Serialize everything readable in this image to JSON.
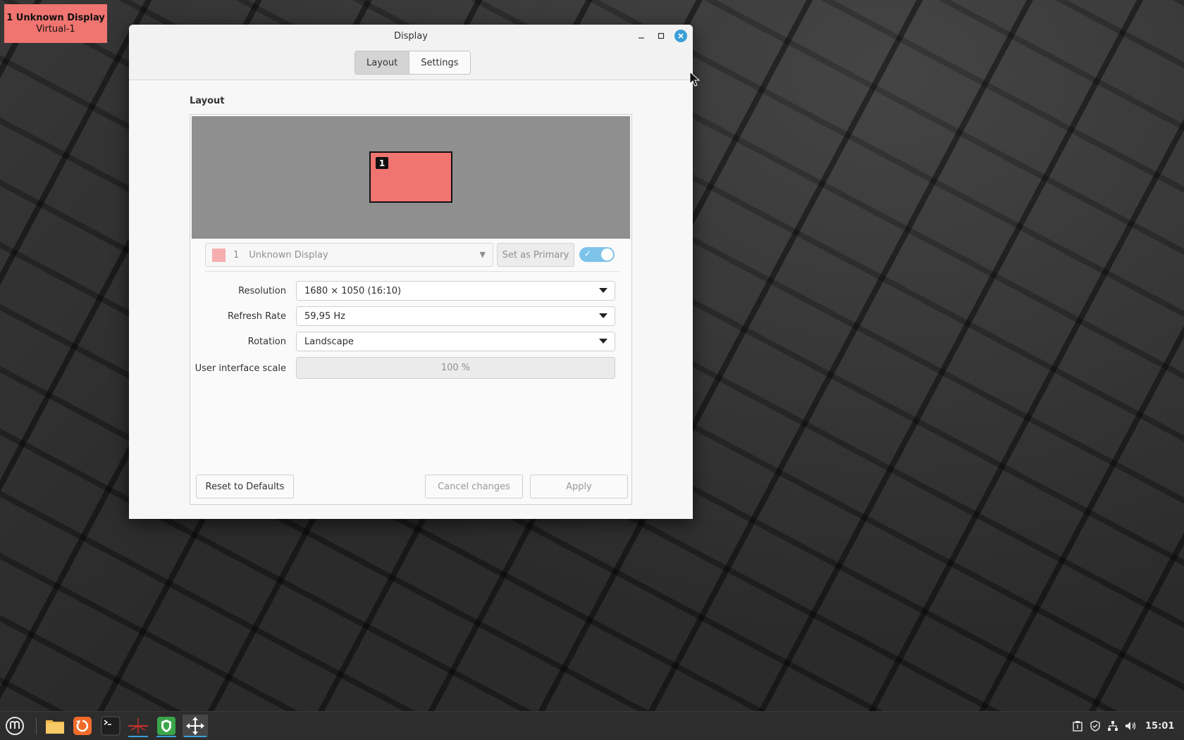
{
  "identify": {
    "line1": "1  Unknown Display",
    "line2": "Virtual-1",
    "color": "#f07470"
  },
  "window": {
    "title": "Display",
    "tabs": [
      {
        "label": "Layout",
        "active": true
      },
      {
        "label": "Settings",
        "active": false
      }
    ]
  },
  "layout": {
    "section_label": "Layout",
    "monitor_badge": "1",
    "monitor_color": "#f07470",
    "display_select": {
      "number": "1",
      "name": "Unknown Display"
    },
    "set_primary_label": "Set as Primary",
    "enabled": true,
    "fields": {
      "resolution": {
        "label": "Resolution",
        "value": "1680 × 1050 (16:10)"
      },
      "refresh_rate": {
        "label": "Refresh Rate",
        "value": "59,95 Hz"
      },
      "rotation": {
        "label": "Rotation",
        "value": "Landscape"
      },
      "scale": {
        "label": "User interface scale",
        "value": "100 %"
      }
    },
    "buttons": {
      "reset": "Reset to Defaults",
      "cancel": "Cancel changes",
      "apply": "Apply"
    }
  },
  "taskbar": {
    "apps": [
      "mint-menu-icon",
      "files-icon",
      "update-manager-icon",
      "terminal-icon",
      "network-app-icon",
      "shield-app-icon",
      "display-app-icon"
    ],
    "clock": "15:01"
  }
}
